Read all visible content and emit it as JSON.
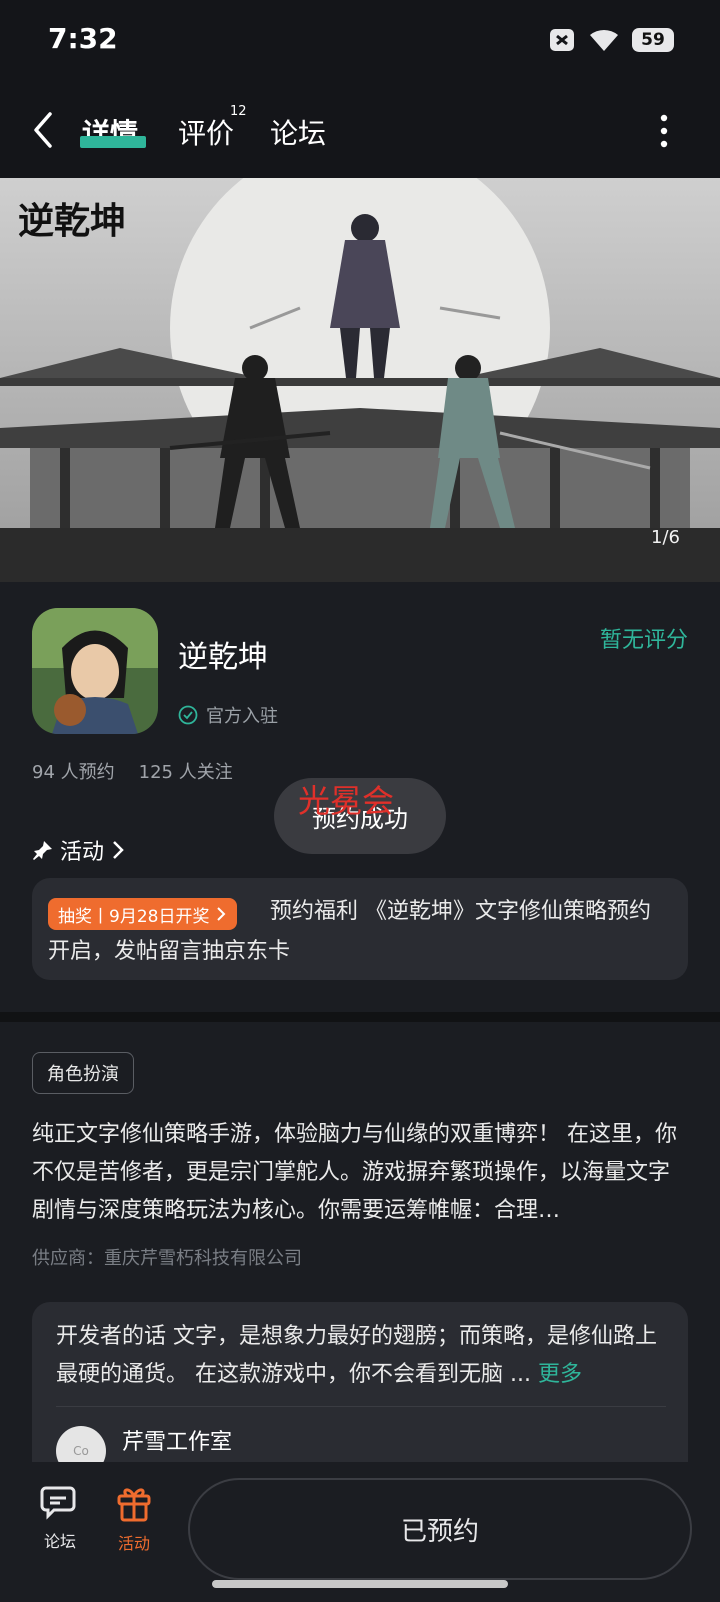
{
  "status_bar": {
    "time": "7:32",
    "battery": "59"
  },
  "header": {
    "tabs": [
      {
        "label": "详情",
        "active": true
      },
      {
        "label": "评价",
        "badge": "12"
      },
      {
        "label": "论坛"
      }
    ]
  },
  "hero": {
    "logo_text": "逆乾坤",
    "counter": "1/6"
  },
  "app": {
    "name": "逆乾坤",
    "official_label": "官方入驻",
    "rating_text": "暂无评分",
    "stats": {
      "reservations": "94 人预约",
      "followers": "125 人关注"
    }
  },
  "toast": {
    "text": "预约成功"
  },
  "watermark": {
    "text": "光冕会"
  },
  "activity": {
    "section_label": "活动",
    "badge": "抽奖丨9月28日开奖",
    "text": "预约福利 《逆乾坤》文字修仙策略预约开启，发帖留言抽京东卡"
  },
  "description": {
    "tag": "角色扮演",
    "text": "纯正文字修仙策略手游，体验脑力与仙缘的双重博弈！ 在这里，你不仅是苦修者，更是宗门掌舵人。游戏摒弃繁琐操作，以海量文字剧情与深度策略玩法为核心。你需要运筹帷幄：合理…",
    "supplier": "供应商：重庆芹雪朽科技有限公司"
  },
  "developer_note": {
    "text": "开发者的话  文字，是想象力最好的翅膀；而策略，是修仙路上最硬的通货。 在这款游戏中，你不会看到无脑 ...",
    "more_label": "更多",
    "studio_name": "芹雪工作室",
    "avatar_text": "Co"
  },
  "bottom_nav": {
    "forum_label": "论坛",
    "activity_label": "活动",
    "reserved_label": "已预约"
  },
  "colors": {
    "accent": "#2fb59a",
    "orange": "#ef6c2e",
    "background": "#1b1d22"
  }
}
